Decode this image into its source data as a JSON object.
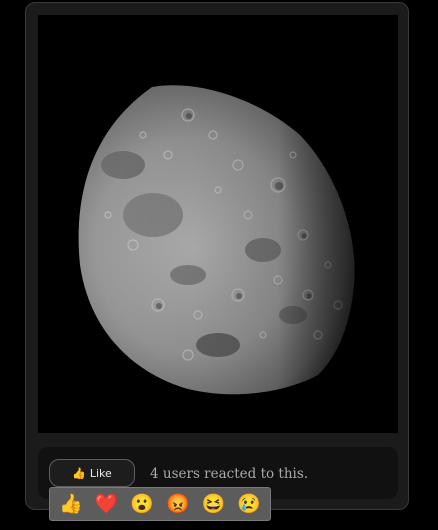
{
  "post": {
    "image_alt": "Photo of the half-lit Moon",
    "like_label": "Like",
    "like_icon": "👍",
    "reaction_summary": "4 users reacted to this."
  },
  "reactions": [
    {
      "name": "thumbs-up",
      "glyph": "👍"
    },
    {
      "name": "heart",
      "glyph": "❤️"
    },
    {
      "name": "surprised",
      "glyph": "😮"
    },
    {
      "name": "angry",
      "glyph": "😡"
    },
    {
      "name": "laughing",
      "glyph": "😆"
    },
    {
      "name": "crying",
      "glyph": "😢"
    }
  ],
  "colors": {
    "page_background": "#000000",
    "card_background": "#1b1b1b",
    "action_bar_background": "#111111",
    "picker_background": "#5c5c5c"
  }
}
